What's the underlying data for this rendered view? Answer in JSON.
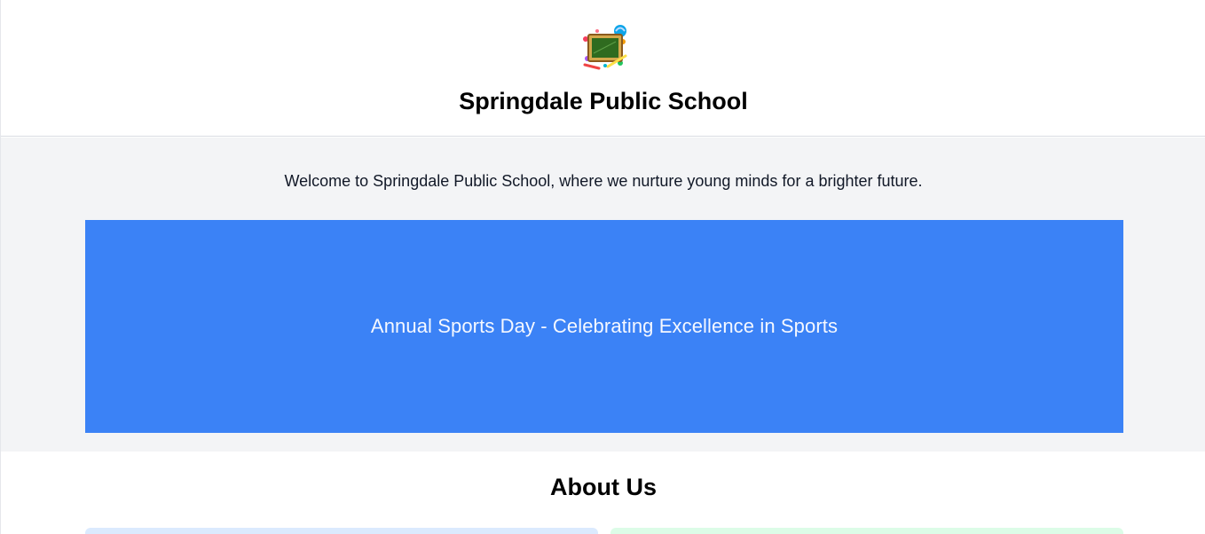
{
  "header": {
    "school_name": "Springdale Public School",
    "logo_icon": "chalkboard-school-logo-icon"
  },
  "hero": {
    "welcome_text": "Welcome to Springdale Public School, where we nurture young minds for a brighter future.",
    "banner_text": "Annual Sports Day - Celebrating Excellence in Sports",
    "banner_color": "#3b82f6"
  },
  "about": {
    "title": "About Us",
    "card_colors": [
      "#dbeafe",
      "#dcfce7"
    ]
  }
}
